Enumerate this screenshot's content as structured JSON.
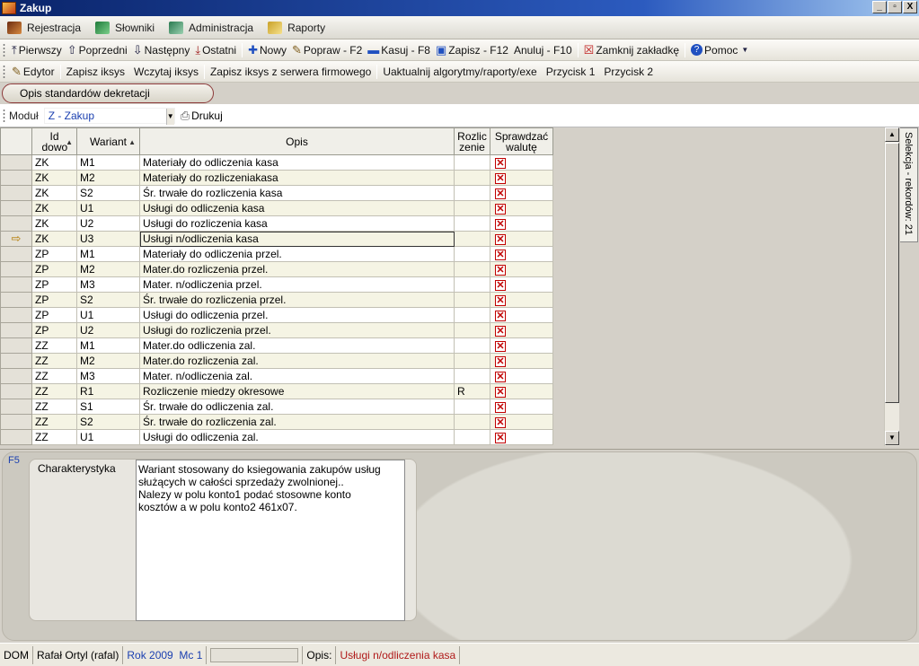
{
  "window": {
    "title": "Zakup",
    "buttons": [
      "_",
      "▫",
      "X"
    ]
  },
  "menu": [
    {
      "label": "Rejestracja",
      "icon": "pen-icon",
      "color": "#6b2b10"
    },
    {
      "label": "Słowniki",
      "icon": "book-icon",
      "color": "#1e7a3a"
    },
    {
      "label": "Administracja",
      "icon": "gear-icon",
      "color": "#2a7a50"
    },
    {
      "label": "Raporty",
      "icon": "report-icon",
      "color": "#c9a22a"
    }
  ],
  "toolbar1": {
    "first": "Pierwszy",
    "prev": "Poprzedni",
    "next": "Następny",
    "last": "Ostatni",
    "new": "Nowy",
    "edit": "Popraw - F2",
    "delete": "Kasuj - F8",
    "save": "Zapisz - F12",
    "cancel": "Anuluj - F10",
    "close_tab": "Zamknij zakładkę",
    "help": "Pomoc"
  },
  "toolbar2": {
    "editor": "Edytor",
    "save_iksys": "Zapisz iksys",
    "load_iksys": "Wczytaj iksys",
    "save_server": "Zapisz iksys z serwera firmowego",
    "update": "Uaktualnij algorytmy/raporty/exe",
    "btn1": "Przycisk 1",
    "btn2": "Przycisk 2"
  },
  "tab": {
    "label": "Opis standardów dekretacji"
  },
  "filter": {
    "label": "Moduł",
    "value": "Z - Zakup",
    "print": "Drukuj"
  },
  "grid": {
    "columns": {
      "id": "Id dowo",
      "variant": "Wariant",
      "opis": "Opis",
      "rozl": "Rozlic zenie",
      "check": "Sprawdzać walutę"
    },
    "selected_index": 5,
    "rows": [
      {
        "id": "ZK",
        "variant": "M1",
        "opis": "Materiały do odliczenia kasa",
        "rozl": "",
        "check": true
      },
      {
        "id": "ZK",
        "variant": "M2",
        "opis": "Materiały do rozliczeniakasa",
        "rozl": "",
        "check": true
      },
      {
        "id": "ZK",
        "variant": "S2",
        "opis": "Śr. trwałe do rozliczenia kasa",
        "rozl": "",
        "check": true
      },
      {
        "id": "ZK",
        "variant": "U1",
        "opis": "Usługi do odliczenia kasa",
        "rozl": "",
        "check": true
      },
      {
        "id": "ZK",
        "variant": "U2",
        "opis": "Usługi do rozliczenia kasa",
        "rozl": "",
        "check": true
      },
      {
        "id": "ZK",
        "variant": "U3",
        "opis": "Usługi n/odliczenia kasa",
        "rozl": "",
        "check": true
      },
      {
        "id": "ZP",
        "variant": "M1",
        "opis": "Materiały do odliczenia przel.",
        "rozl": "",
        "check": true
      },
      {
        "id": "ZP",
        "variant": "M2",
        "opis": "Mater.do rozliczenia przel.",
        "rozl": "",
        "check": true
      },
      {
        "id": "ZP",
        "variant": "M3",
        "opis": "Mater. n/odliczenia przel.",
        "rozl": "",
        "check": true
      },
      {
        "id": "ZP",
        "variant": "S2",
        "opis": "Śr. trwałe do rozliczenia przel.",
        "rozl": "",
        "check": true
      },
      {
        "id": "ZP",
        "variant": "U1",
        "opis": "Usługi do odliczenia przel.",
        "rozl": "",
        "check": true
      },
      {
        "id": "ZP",
        "variant": "U2",
        "opis": "Usługi do rozliczenia przel.",
        "rozl": "",
        "check": true
      },
      {
        "id": "ZZ",
        "variant": "M1",
        "opis": "Mater.do odliczenia zal.",
        "rozl": "",
        "check": true
      },
      {
        "id": "ZZ",
        "variant": "M2",
        "opis": "Mater.do rozliczenia zal.",
        "rozl": "",
        "check": true
      },
      {
        "id": "ZZ",
        "variant": "M3",
        "opis": "Mater. n/odliczenia zal.",
        "rozl": "",
        "check": true
      },
      {
        "id": "ZZ",
        "variant": "R1",
        "opis": "Rozliczenie miedzy okresowe",
        "rozl": "R",
        "check": true
      },
      {
        "id": "ZZ",
        "variant": "S1",
        "opis": "Śr. trwałe do odliczenia zal.",
        "rozl": "",
        "check": true
      },
      {
        "id": "ZZ",
        "variant": "S2",
        "opis": "Śr. trwałe do rozliczenia zal.",
        "rozl": "",
        "check": true
      },
      {
        "id": "ZZ",
        "variant": "U1",
        "opis": "Usługi do odliczenia zal.",
        "rozl": "",
        "check": true
      }
    ]
  },
  "sidetab": {
    "label": "Selekcja - rekordów: 21"
  },
  "detail": {
    "hotkey": "F5",
    "label": "Charakterystyka",
    "text": "Wariant stosowany do ksiegowania zakupów usług\nsłużących w całości sprzedaży zwolnionej..\nNalezy w polu konto1 podać stosowne konto\nkosztów a w polu konto2 461x07."
  },
  "status": {
    "dom": "DOM",
    "user": "Rafał Ortyl (rafal)",
    "year": "Rok 2009",
    "month": "Mc 1",
    "blank": "",
    "opis_label": "Opis:",
    "opis_value": "Usługi n/odliczenia kasa"
  }
}
